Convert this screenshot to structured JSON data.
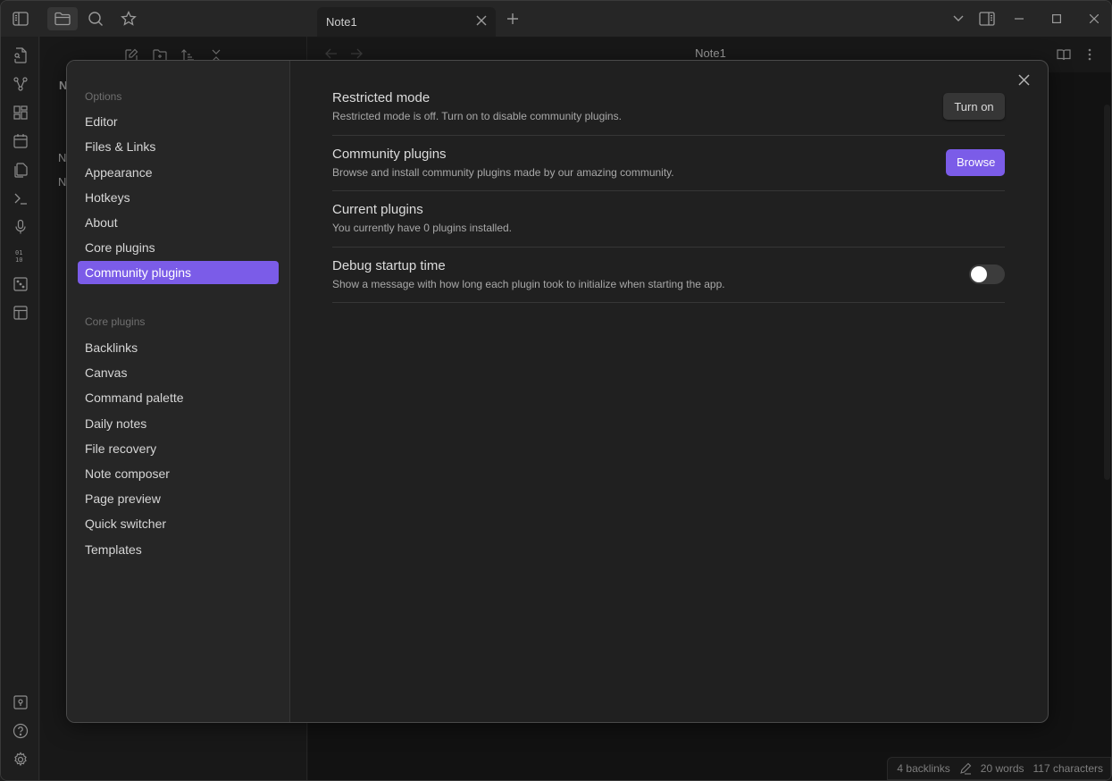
{
  "titlebar": {
    "left_icons": [
      "sidebar-toggle-icon",
      "folder-icon",
      "search-icon",
      "bookmark-star-icon"
    ],
    "active_tab": "Note1",
    "tab_close_glyph": "✕",
    "new_tab_glyph": "+",
    "window_controls": [
      "tab-list-chevron-icon",
      "right-sidebar-toggle-icon",
      "minimize-icon",
      "maximize-icon",
      "close-icon"
    ]
  },
  "ribbon": {
    "top_icons": [
      "quick-switcher-icon",
      "graph-view-icon",
      "canvas-icon",
      "daily-note-icon",
      "templates-icon",
      "command-palette-icon",
      "audio-recorder-icon",
      "slides-icon",
      "random-note-icon",
      "workspace-layout-icon"
    ],
    "bottom_icons": [
      "vault-switch-icon",
      "help-icon",
      "settings-gear-icon"
    ]
  },
  "explorer": {
    "toolbar": [
      "new-note-icon",
      "new-folder-icon",
      "sort-icon",
      "collapse-all-icon"
    ],
    "partial_items": [
      "N",
      "N",
      "N"
    ]
  },
  "editor": {
    "title": "Note1",
    "back_glyph": "←",
    "forward_glyph": "→"
  },
  "statusbar": {
    "backlinks": "4 backlinks",
    "words": "20 words",
    "characters": "117 characters"
  },
  "settings_modal": {
    "close_glyph": "✕",
    "sidebar": {
      "options_heading": "Options",
      "options_items": [
        {
          "label": "Editor",
          "active": false
        },
        {
          "label": "Files & Links",
          "active": false
        },
        {
          "label": "Appearance",
          "active": false
        },
        {
          "label": "Hotkeys",
          "active": false
        },
        {
          "label": "About",
          "active": false
        },
        {
          "label": "Core plugins",
          "active": false
        },
        {
          "label": "Community plugins",
          "active": true
        }
      ],
      "core_plugins_heading": "Core plugins",
      "core_plugins_items": [
        {
          "label": "Backlinks"
        },
        {
          "label": "Canvas"
        },
        {
          "label": "Command palette"
        },
        {
          "label": "Daily notes"
        },
        {
          "label": "File recovery"
        },
        {
          "label": "Note composer"
        },
        {
          "label": "Page preview"
        },
        {
          "label": "Quick switcher"
        },
        {
          "label": "Templates"
        }
      ]
    },
    "settings": [
      {
        "name": "Restricted mode",
        "description": "Restricted mode is off. Turn on to disable community plugins.",
        "control": {
          "type": "button",
          "label": "Turn on",
          "style": "secondary"
        }
      },
      {
        "name": "Community plugins",
        "description": "Browse and install community plugins made by our amazing community.",
        "control": {
          "type": "button",
          "label": "Browse",
          "style": "primary"
        }
      },
      {
        "name": "Current plugins",
        "description": "You currently have 0 plugins installed.",
        "control": null
      },
      {
        "name": "Debug startup time",
        "description": "Show a message with how long each plugin took to initialize when starting the app.",
        "control": {
          "type": "toggle",
          "enabled": false
        }
      }
    ]
  },
  "colors": {
    "accent": "#7b5ce8",
    "background": "#1e1e1e",
    "modal_sidebar": "#262626",
    "modal_content": "#202020"
  }
}
